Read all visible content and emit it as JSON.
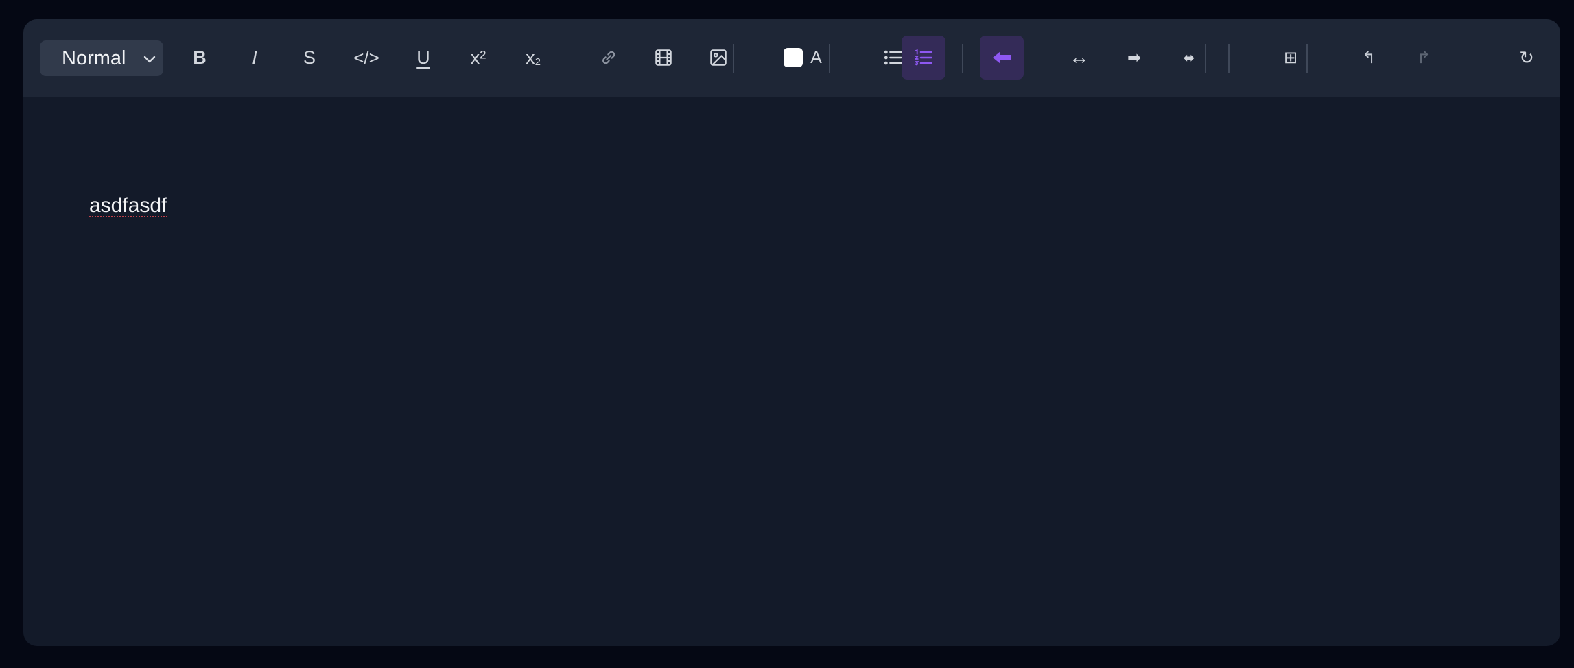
{
  "toolbar": {
    "heading_select": {
      "value": "Normal",
      "options": [
        "Normal"
      ]
    },
    "bold_label": "B",
    "italic_label": "I",
    "strike_label": "S",
    "code_label": "</>",
    "underline_label": "U",
    "superscript_label": "x²",
    "subscript_base": "x",
    "subscript_sub": "2",
    "text_color_label": "A",
    "text_color_value": "#ffffff",
    "align_center_label": "↔",
    "align_right_label": "➡",
    "align_justify_label": "⬌",
    "table_label": "⊞",
    "undo_label": "↰",
    "redo_label": "↱",
    "refresh_label": "↻",
    "icons": {
      "link": "link-icon",
      "video": "film-icon",
      "image": "image-icon",
      "bullet_list": "bullet-list-icon",
      "ordered_list": "ordered-list-icon",
      "align_left": "arrow-left-icon"
    },
    "active_tools": [
      "ordered_list",
      "align_left"
    ]
  },
  "editor": {
    "content": "asdfasdf"
  },
  "colors": {
    "accent": "#8e58f2",
    "active_bg": "#342b58",
    "toolbar_bg": "#1e2636",
    "editor_bg": "#131a29",
    "page_bg": "#050814",
    "spellcheck_underline": "#c0404a"
  }
}
